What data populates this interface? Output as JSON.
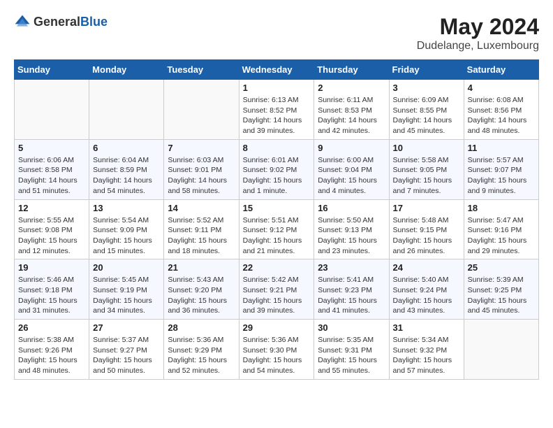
{
  "header": {
    "logo_general": "General",
    "logo_blue": "Blue",
    "title": "May 2024",
    "subtitle": "Dudelange, Luxembourg"
  },
  "calendar": {
    "days_of_week": [
      "Sunday",
      "Monday",
      "Tuesday",
      "Wednesday",
      "Thursday",
      "Friday",
      "Saturday"
    ],
    "weeks": [
      [
        {
          "day": "",
          "detail": ""
        },
        {
          "day": "",
          "detail": ""
        },
        {
          "day": "",
          "detail": ""
        },
        {
          "day": "1",
          "detail": "Sunrise: 6:13 AM\nSunset: 8:52 PM\nDaylight: 14 hours\nand 39 minutes."
        },
        {
          "day": "2",
          "detail": "Sunrise: 6:11 AM\nSunset: 8:53 PM\nDaylight: 14 hours\nand 42 minutes."
        },
        {
          "day": "3",
          "detail": "Sunrise: 6:09 AM\nSunset: 8:55 PM\nDaylight: 14 hours\nand 45 minutes."
        },
        {
          "day": "4",
          "detail": "Sunrise: 6:08 AM\nSunset: 8:56 PM\nDaylight: 14 hours\nand 48 minutes."
        }
      ],
      [
        {
          "day": "5",
          "detail": "Sunrise: 6:06 AM\nSunset: 8:58 PM\nDaylight: 14 hours\nand 51 minutes."
        },
        {
          "day": "6",
          "detail": "Sunrise: 6:04 AM\nSunset: 8:59 PM\nDaylight: 14 hours\nand 54 minutes."
        },
        {
          "day": "7",
          "detail": "Sunrise: 6:03 AM\nSunset: 9:01 PM\nDaylight: 14 hours\nand 58 minutes."
        },
        {
          "day": "8",
          "detail": "Sunrise: 6:01 AM\nSunset: 9:02 PM\nDaylight: 15 hours\nand 1 minute."
        },
        {
          "day": "9",
          "detail": "Sunrise: 6:00 AM\nSunset: 9:04 PM\nDaylight: 15 hours\nand 4 minutes."
        },
        {
          "day": "10",
          "detail": "Sunrise: 5:58 AM\nSunset: 9:05 PM\nDaylight: 15 hours\nand 7 minutes."
        },
        {
          "day": "11",
          "detail": "Sunrise: 5:57 AM\nSunset: 9:07 PM\nDaylight: 15 hours\nand 9 minutes."
        }
      ],
      [
        {
          "day": "12",
          "detail": "Sunrise: 5:55 AM\nSunset: 9:08 PM\nDaylight: 15 hours\nand 12 minutes."
        },
        {
          "day": "13",
          "detail": "Sunrise: 5:54 AM\nSunset: 9:09 PM\nDaylight: 15 hours\nand 15 minutes."
        },
        {
          "day": "14",
          "detail": "Sunrise: 5:52 AM\nSunset: 9:11 PM\nDaylight: 15 hours\nand 18 minutes."
        },
        {
          "day": "15",
          "detail": "Sunrise: 5:51 AM\nSunset: 9:12 PM\nDaylight: 15 hours\nand 21 minutes."
        },
        {
          "day": "16",
          "detail": "Sunrise: 5:50 AM\nSunset: 9:13 PM\nDaylight: 15 hours\nand 23 minutes."
        },
        {
          "day": "17",
          "detail": "Sunrise: 5:48 AM\nSunset: 9:15 PM\nDaylight: 15 hours\nand 26 minutes."
        },
        {
          "day": "18",
          "detail": "Sunrise: 5:47 AM\nSunset: 9:16 PM\nDaylight: 15 hours\nand 29 minutes."
        }
      ],
      [
        {
          "day": "19",
          "detail": "Sunrise: 5:46 AM\nSunset: 9:18 PM\nDaylight: 15 hours\nand 31 minutes."
        },
        {
          "day": "20",
          "detail": "Sunrise: 5:45 AM\nSunset: 9:19 PM\nDaylight: 15 hours\nand 34 minutes."
        },
        {
          "day": "21",
          "detail": "Sunrise: 5:43 AM\nSunset: 9:20 PM\nDaylight: 15 hours\nand 36 minutes."
        },
        {
          "day": "22",
          "detail": "Sunrise: 5:42 AM\nSunset: 9:21 PM\nDaylight: 15 hours\nand 39 minutes."
        },
        {
          "day": "23",
          "detail": "Sunrise: 5:41 AM\nSunset: 9:23 PM\nDaylight: 15 hours\nand 41 minutes."
        },
        {
          "day": "24",
          "detail": "Sunrise: 5:40 AM\nSunset: 9:24 PM\nDaylight: 15 hours\nand 43 minutes."
        },
        {
          "day": "25",
          "detail": "Sunrise: 5:39 AM\nSunset: 9:25 PM\nDaylight: 15 hours\nand 45 minutes."
        }
      ],
      [
        {
          "day": "26",
          "detail": "Sunrise: 5:38 AM\nSunset: 9:26 PM\nDaylight: 15 hours\nand 48 minutes."
        },
        {
          "day": "27",
          "detail": "Sunrise: 5:37 AM\nSunset: 9:27 PM\nDaylight: 15 hours\nand 50 minutes."
        },
        {
          "day": "28",
          "detail": "Sunrise: 5:36 AM\nSunset: 9:29 PM\nDaylight: 15 hours\nand 52 minutes."
        },
        {
          "day": "29",
          "detail": "Sunrise: 5:36 AM\nSunset: 9:30 PM\nDaylight: 15 hours\nand 54 minutes."
        },
        {
          "day": "30",
          "detail": "Sunrise: 5:35 AM\nSunset: 9:31 PM\nDaylight: 15 hours\nand 55 minutes."
        },
        {
          "day": "31",
          "detail": "Sunrise: 5:34 AM\nSunset: 9:32 PM\nDaylight: 15 hours\nand 57 minutes."
        },
        {
          "day": "",
          "detail": ""
        }
      ]
    ]
  }
}
